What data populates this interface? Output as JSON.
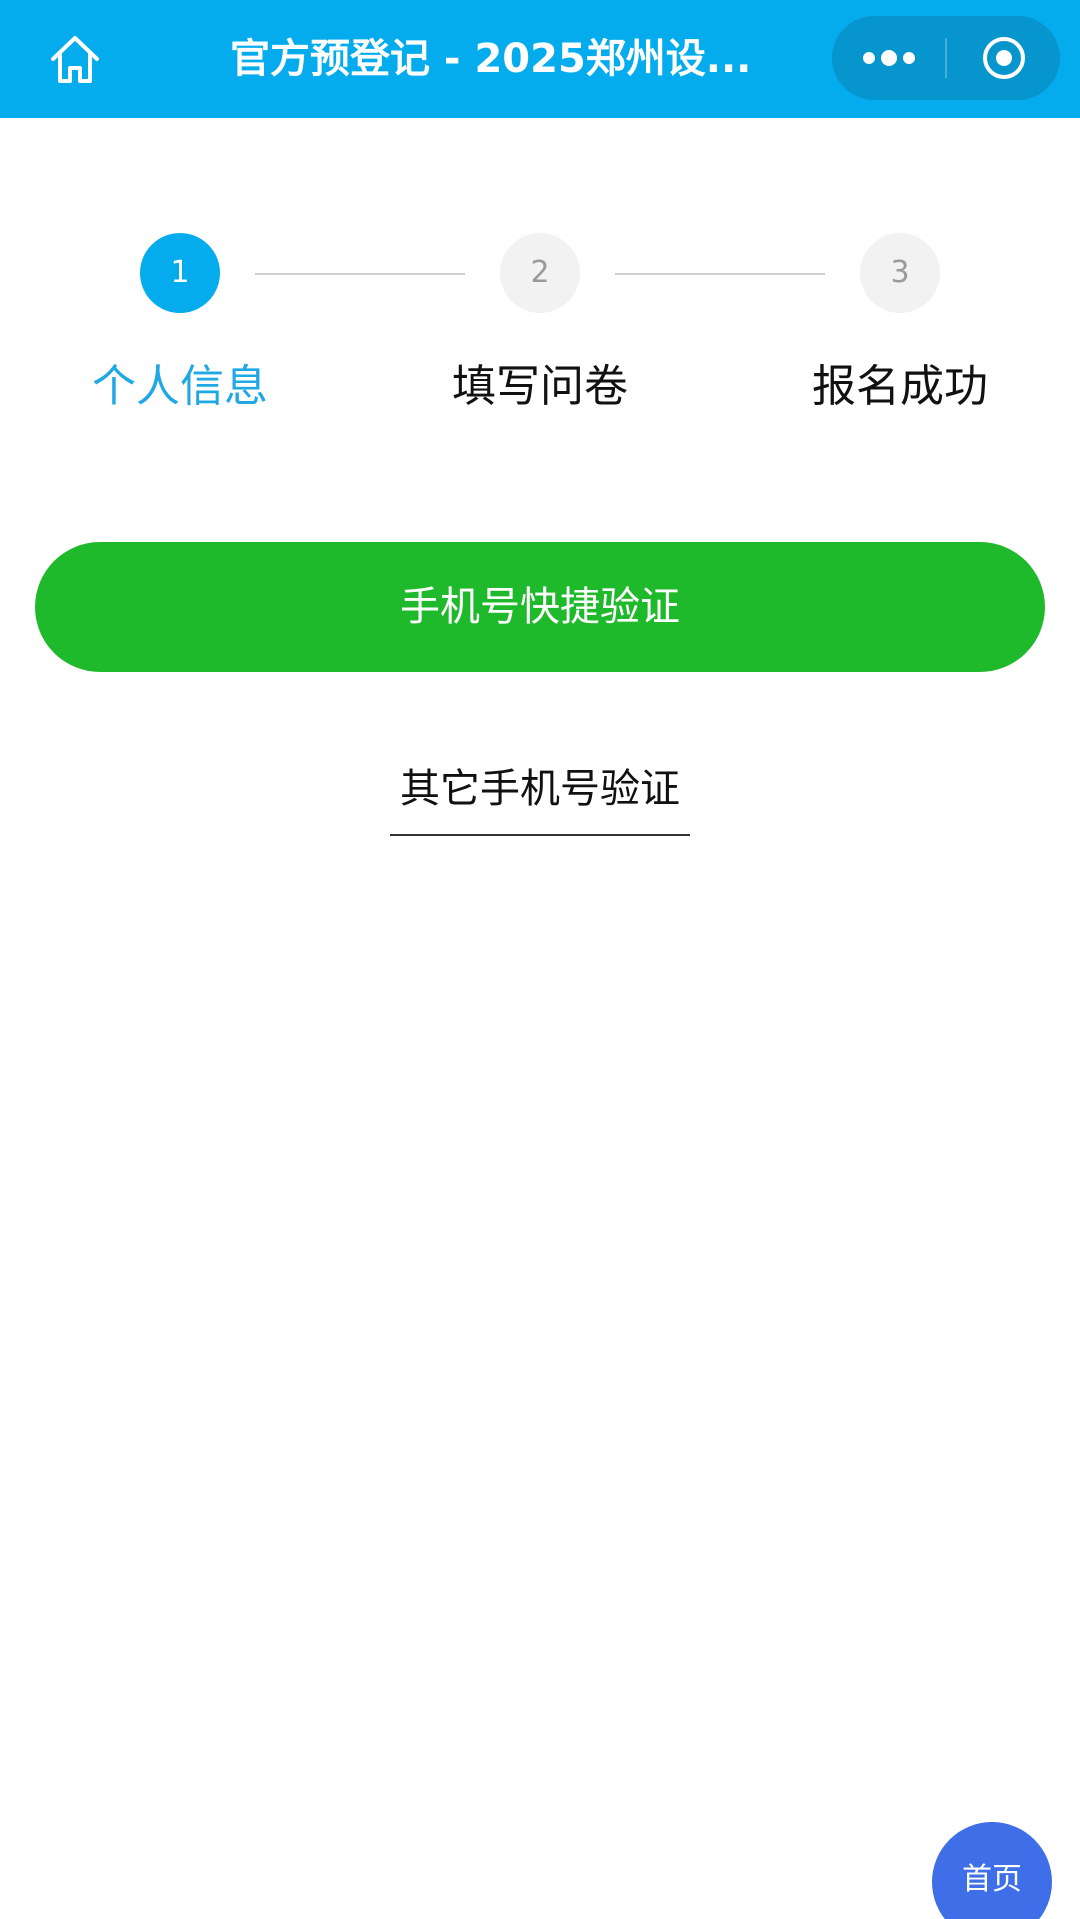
{
  "header": {
    "title": "官方预登记 - 2025郑州设...",
    "home_icon": "home-icon",
    "more_icon": "more-dots-icon",
    "close_icon": "target-close-icon"
  },
  "steps": [
    {
      "number": "1",
      "label": "个人信息",
      "state": "active"
    },
    {
      "number": "2",
      "label": "填写问卷",
      "state": "inactive"
    },
    {
      "number": "3",
      "label": "报名成功",
      "state": "inactive"
    }
  ],
  "actions": {
    "quick_verify_label": "手机号快捷验证",
    "other_verify_label": "其它手机号验证"
  },
  "floating": {
    "home_label": "首页"
  },
  "colors": {
    "header_bg": "#04abed",
    "step_active": "#04abed",
    "primary_button": "#1fba2b",
    "floating_button": "#3f6fe8"
  }
}
